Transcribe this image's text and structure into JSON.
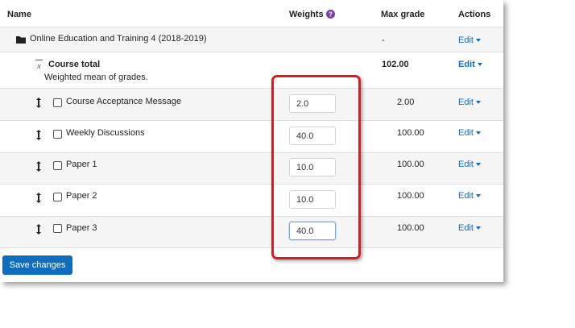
{
  "header": {
    "name": "Name",
    "weights": "Weights",
    "max_grade": "Max grade",
    "actions": "Actions"
  },
  "category": {
    "name": "Online Education and Training 4 (2018-2019)",
    "max_grade": "-",
    "action": "Edit"
  },
  "course_total": {
    "label": "Course total",
    "sub": "Weighted mean of grades.",
    "max_grade": "102.00",
    "action": "Edit"
  },
  "items": [
    {
      "name": "Course Acceptance Message",
      "weight": "2.0",
      "max_grade": "2.00",
      "action": "Edit"
    },
    {
      "name": "Weekly Discussions",
      "weight": "40.0",
      "max_grade": "100.00",
      "action": "Edit"
    },
    {
      "name": "Paper 1",
      "weight": "10.0",
      "max_grade": "100.00",
      "action": "Edit"
    },
    {
      "name": "Paper 2",
      "weight": "10.0",
      "max_grade": "100.00",
      "action": "Edit"
    },
    {
      "name": "Paper 3",
      "weight": "40.0",
      "max_grade": "100.00",
      "action": "Edit"
    }
  ],
  "save_label": "Save changes",
  "colors": {
    "accent": "#0f6cbf",
    "highlight": "#d71c22",
    "help_icon": "#7a3fa0"
  },
  "icons": {
    "category": "folder-icon",
    "course_total": "xbar-mean-icon",
    "help": "question-circle-icon",
    "move": "move-vertical-icon"
  }
}
